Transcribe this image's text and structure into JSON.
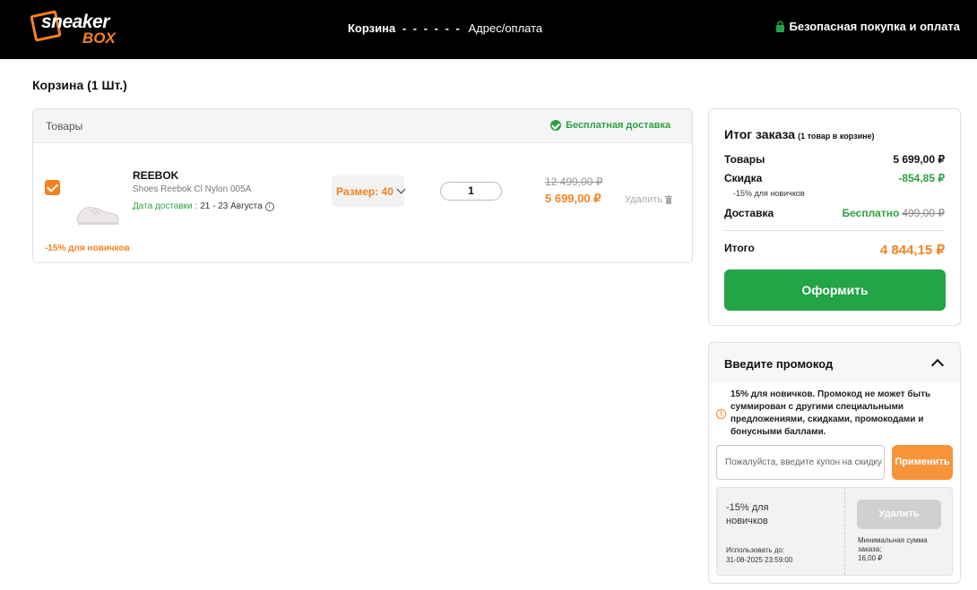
{
  "header": {
    "logo_line1": "sneaker",
    "logo_line2": "BOX",
    "step1": "Корзина",
    "step_separator": "- - - - - -",
    "step2": "Адрес/оплата",
    "secure_label": "Безопасная покупка и оплата"
  },
  "page": {
    "title": "Корзина (1 Шт.)"
  },
  "cart": {
    "column_goods": "Товары",
    "free_shipping": "Бесплатная доставка",
    "item": {
      "checked": true,
      "brand": "REEBOK",
      "model": "Shoes Reebok Cl Nylon 005A",
      "delivery_label": "Дата доставки :",
      "delivery_value": "21 - 23 Августа",
      "size_label": "Размер: 40",
      "quantity": "1",
      "old_price": "12 499,00 ₽",
      "new_price": "5 699,00 ₽",
      "remove_label": "Удалить",
      "discount_note": "-15% для новичков"
    }
  },
  "summary": {
    "title": "Итог заказа",
    "title_note": "(1 товар в корзине)",
    "goods_label": "Товары",
    "goods_value": "5 699,00 ₽",
    "discount_label": "Скидка",
    "discount_value": "-854,85 ₽",
    "discount_note": "-15% для новичков",
    "delivery_label": "Доставка",
    "delivery_value": "Бесплатно",
    "delivery_old": "499,00 ₽",
    "total_label": "Итого",
    "total_value": "4 844,15 ₽",
    "checkout_button": "Оформить"
  },
  "promo": {
    "title": "Введите промокод",
    "note": "15% для новичков. Промокод не может быть суммирован с другими специальными предложениями, скидками, промокодами и бонусными баллами.",
    "input_placeholder": "Пожалуйста, введите купон на скидку",
    "apply_button": "Применить",
    "coupon": {
      "name": "-15% для новичков",
      "valid_until_label": "Использовать до:",
      "valid_until": "31-08-2025 23:59:00",
      "remove_button": "Удалить",
      "min_label": "Минимальная сумма заказа:",
      "min_value": "16,00 ₽"
    }
  },
  "colors": {
    "accent": "#f5821f",
    "success": "#22a447",
    "header_bg": "#000000"
  }
}
